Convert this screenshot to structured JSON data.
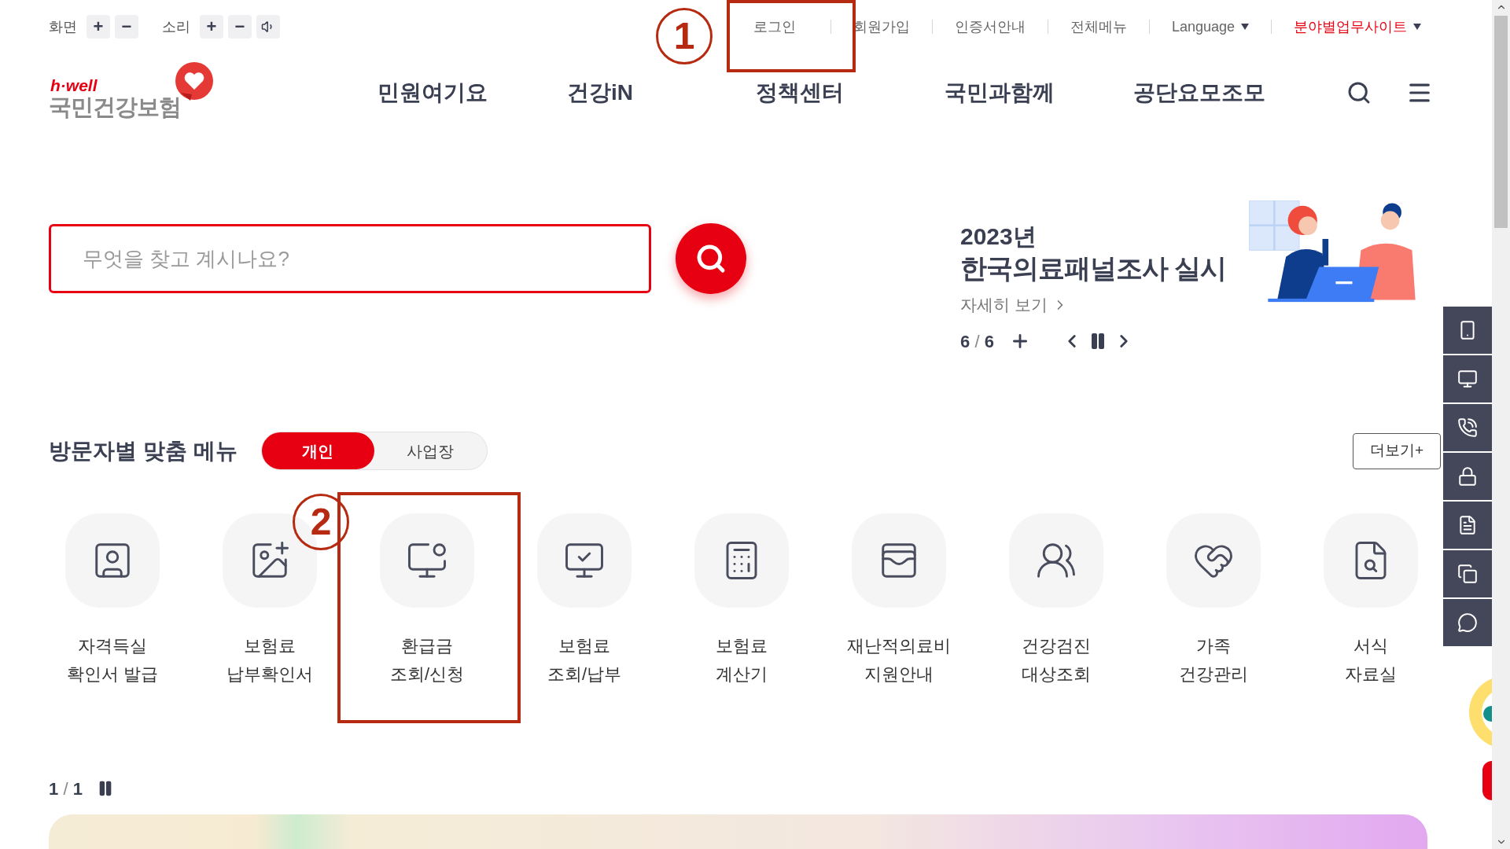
{
  "utility_bar": {
    "screen": {
      "label": "화면",
      "buttons": [
        "+",
        "−"
      ]
    },
    "sound": {
      "label": "소리",
      "buttons": [
        "+",
        "−"
      ]
    }
  },
  "top_links": [
    {
      "label": "로그인",
      "dropdown": false,
      "accent": false
    },
    {
      "label": "회원가입",
      "dropdown": false,
      "accent": false
    },
    {
      "label": "인증서안내",
      "dropdown": false,
      "accent": false
    },
    {
      "label": "전체메뉴",
      "dropdown": false,
      "accent": false
    },
    {
      "label": "Language",
      "dropdown": true,
      "accent": false
    },
    {
      "label": "분야별업무사이트",
      "dropdown": true,
      "accent": true
    }
  ],
  "logo": {
    "tagline": "h·well",
    "name": "국민건강보험"
  },
  "nav": [
    "민원여기요",
    "건강iN",
    "정책센터",
    "국민과함께",
    "공단요모조모"
  ],
  "search": {
    "placeholder": "무엇을 찾고 계시나요?"
  },
  "banner": {
    "year": "2023년",
    "headline": "한국의료패널조사 실시",
    "link": "자세히 보기",
    "pager": {
      "current": "6",
      "separator": "/",
      "total": "6"
    }
  },
  "visitor_menu": {
    "title": "방문자별 맞춤 메뉴",
    "tabs": [
      {
        "label": "개인",
        "selected": true
      },
      {
        "label": "사업장",
        "selected": false
      }
    ],
    "more": "더보기+",
    "items": [
      {
        "lines": [
          "자격득실",
          "확인서 발급"
        ]
      },
      {
        "lines": [
          "보험료",
          "납부확인서"
        ]
      },
      {
        "lines": [
          "환급금",
          "조회/신청"
        ]
      },
      {
        "lines": [
          "보험료",
          "조회/납부"
        ]
      },
      {
        "lines": [
          "보험료",
          "계산기"
        ]
      },
      {
        "lines": [
          "재난적의료비",
          "지원안내"
        ]
      },
      {
        "lines": [
          "건강검진",
          "대상조회"
        ]
      },
      {
        "lines": [
          "가족",
          "건강관리"
        ]
      },
      {
        "lines": [
          "서식",
          "자료실"
        ]
      }
    ],
    "pager": {
      "current": "1",
      "separator": "/",
      "total": "1"
    }
  },
  "annotations": [
    {
      "label": "1"
    },
    {
      "label": "2"
    }
  ]
}
